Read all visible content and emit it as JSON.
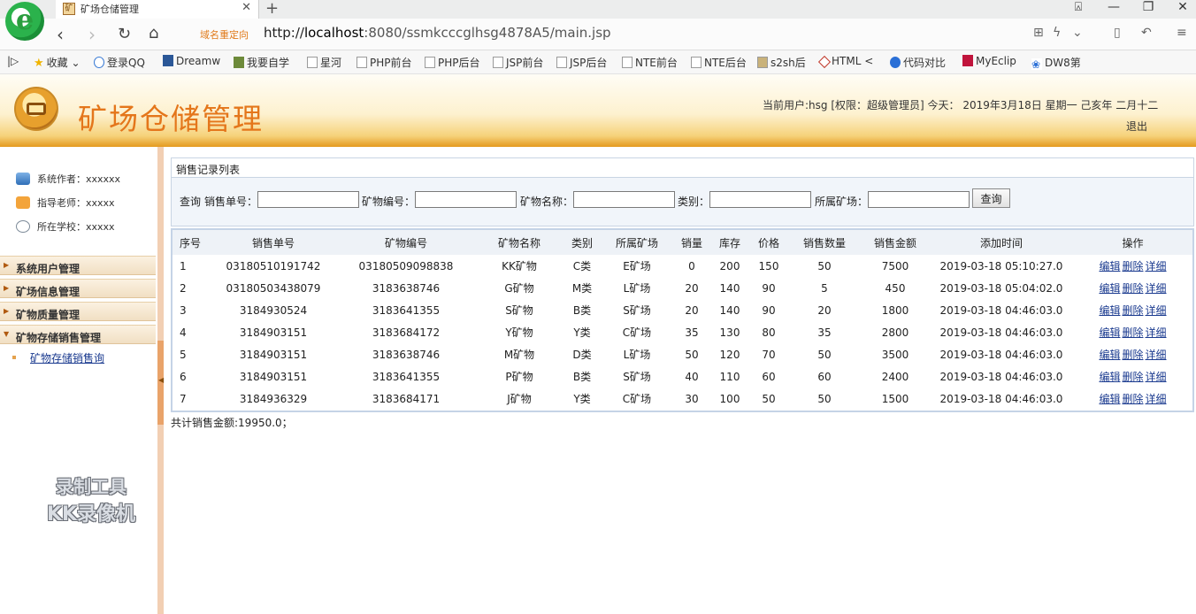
{
  "browser": {
    "tab_title": "矿场仓储管理",
    "tab_favicon": "矿",
    "logo_letter": "e",
    "redirect_label": "域名重定向",
    "url_prefix": "http://",
    "url_host": "localhost",
    "url_path": ":8080/ssmkcccglhsg4878A5/main.jsp",
    "bookmarks": [
      "收藏",
      "登录QQ",
      "Dreamw",
      "我要自学",
      "星河",
      "PHP前台",
      "PHP后台",
      "JSP前台",
      "JSP后台",
      "NTE前台",
      "NTE后台",
      "s2sh后",
      "HTML <",
      "代码对比",
      "MyEclip",
      "DW8第"
    ]
  },
  "header": {
    "title": "矿场仓储管理",
    "user_info": "当前用户:hsg [权限：超级管理员] 今天： 2019年3月18日 星期一 己亥年 二月十二",
    "logout": "退出"
  },
  "sidebar": {
    "info": [
      "系统作者：xxxxxx",
      "指导老师：xxxxx",
      "所在学校：xxxxx"
    ],
    "menu": [
      "系统用户管理",
      "矿场信息管理",
      "矿物质量管理",
      "矿物存储销售管理"
    ],
    "sub_item": "矿物存储销售询",
    "watermark_line1": "录制工具",
    "watermark_line2": "KK录像机"
  },
  "main": {
    "panel_title": "销售记录列表",
    "search": {
      "prefix": "查询",
      "labels": [
        "销售单号：",
        "矿物编号：",
        "矿物名称：",
        "类别：",
        "所属矿场："
      ],
      "button": "查询"
    },
    "columns": [
      "序号",
      "销售单号",
      "矿物编号",
      "矿物名称",
      "类别",
      "所属矿场",
      "销量",
      "库存",
      "价格",
      "销售数量",
      "销售金额",
      "添加时间",
      "操作"
    ],
    "rows": [
      [
        "1",
        "03180510191742",
        "03180509098838",
        "KK矿物",
        "C类",
        "E矿场",
        "0",
        "200",
        "150",
        "50",
        "7500",
        "2019-03-18 05:10:27.0"
      ],
      [
        "2",
        "03180503438079",
        "3183638746",
        "G矿物",
        "M类",
        "L矿场",
        "20",
        "140",
        "90",
        "5",
        "450",
        "2019-03-18 05:04:02.0"
      ],
      [
        "3",
        "3184930524",
        "3183641355",
        "S矿物",
        "B类",
        "S矿场",
        "20",
        "140",
        "90",
        "20",
        "1800",
        "2019-03-18 04:46:03.0"
      ],
      [
        "4",
        "3184903151",
        "3183684172",
        "Y矿物",
        "Y类",
        "C矿场",
        "35",
        "130",
        "80",
        "35",
        "2800",
        "2019-03-18 04:46:03.0"
      ],
      [
        "5",
        "3184903151",
        "3183638746",
        "M矿物",
        "D类",
        "L矿场",
        "50",
        "120",
        "70",
        "50",
        "3500",
        "2019-03-18 04:46:03.0"
      ],
      [
        "6",
        "3184903151",
        "3183641355",
        "P矿物",
        "B类",
        "S矿场",
        "40",
        "110",
        "60",
        "60",
        "2400",
        "2019-03-18 04:46:03.0"
      ],
      [
        "7",
        "3184936329",
        "3183684171",
        "J矿物",
        "Y类",
        "C矿场",
        "30",
        "100",
        "50",
        "50",
        "1500",
        "2019-03-18 04:46:03.0"
      ]
    ],
    "actions": [
      "编辑",
      "删除",
      "详细"
    ],
    "total": "共计销售金额:19950.0；"
  }
}
